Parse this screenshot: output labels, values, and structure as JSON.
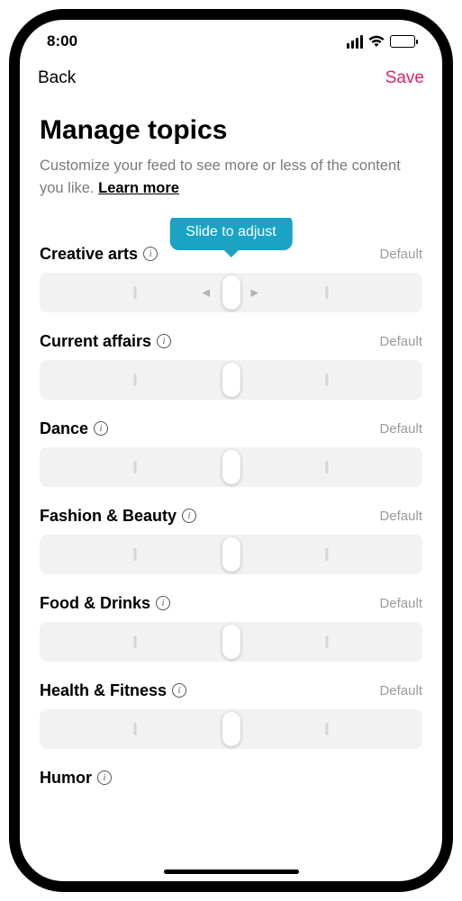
{
  "statusBar": {
    "time": "8:00"
  },
  "nav": {
    "back": "Back",
    "save": "Save"
  },
  "page": {
    "title": "Manage topics",
    "subtitle_prefix": "Customize your feed to see more or less of the content you like. ",
    "learn_more": "Learn more"
  },
  "tooltip": "Slide to adjust",
  "topics": [
    {
      "name": "Creative arts",
      "status": "Default",
      "showTooltip": true,
      "showArrows": true
    },
    {
      "name": "Current affairs",
      "status": "Default",
      "showTooltip": false,
      "showArrows": false
    },
    {
      "name": "Dance",
      "status": "Default",
      "showTooltip": false,
      "showArrows": false
    },
    {
      "name": "Fashion & Beauty",
      "status": "Default",
      "showTooltip": false,
      "showArrows": false
    },
    {
      "name": "Food & Drinks",
      "status": "Default",
      "showTooltip": false,
      "showArrows": false
    },
    {
      "name": "Health & Fitness",
      "status": "Default",
      "showTooltip": false,
      "showArrows": false
    }
  ],
  "lastTopic": {
    "name": "Humor"
  }
}
